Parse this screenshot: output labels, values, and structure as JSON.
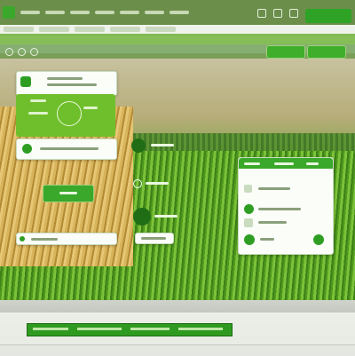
{
  "colors": {
    "accent": "#2e9e22",
    "accent_light": "#6fbf2c",
    "titlebar": "#6b8f4a",
    "card_background": "#fbfdf9"
  },
  "topbar": {
    "menu_items": [
      "",
      "",
      "",
      "",
      "",
      "",
      ""
    ],
    "action_label": ""
  },
  "tabs": [
    "",
    "",
    "",
    "",
    ""
  ],
  "toolbar": {
    "breadcrumb": "",
    "button_1": "",
    "button_2": ""
  },
  "card_top": {
    "title": "",
    "subtitle": ""
  },
  "green_panel": {
    "line_1": "",
    "line_2": "",
    "line_3": ""
  },
  "card_mid": {
    "label": ""
  },
  "marker_1": {
    "label": ""
  },
  "green_button": {
    "label": ""
  },
  "marker_2": {
    "label": ""
  },
  "marker_3": {
    "label": ""
  },
  "card_bottom": {
    "label": ""
  },
  "chip_bottom": {
    "label": ""
  },
  "right_panel": {
    "header": [
      "",
      "",
      ""
    ],
    "rows": [
      "",
      "",
      "",
      ""
    ]
  },
  "bottom": {
    "progress_segments": [
      "",
      "",
      "",
      ""
    ]
  },
  "statusbar": {
    "text": ""
  }
}
